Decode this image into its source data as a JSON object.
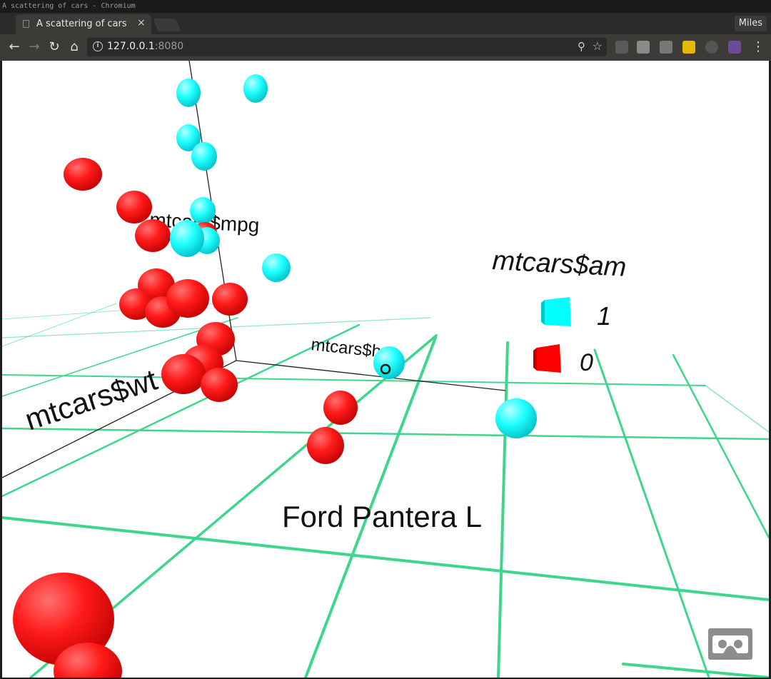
{
  "window": {
    "title": "A scattering of cars - Chromium"
  },
  "tab": {
    "title": "A scattering of cars",
    "close_glyph": "×"
  },
  "profile": {
    "name": "Miles"
  },
  "address": {
    "host": "127.0.0.1",
    "port": ":8080"
  },
  "scene": {
    "axis_labels": {
      "y": "mtcars$mpg",
      "x": "mtcars$hp",
      "z": "mtcars$wt"
    },
    "legend": {
      "title": "mtcars$am",
      "items": [
        {
          "label": "1",
          "color": "#00ffff"
        },
        {
          "label": "0",
          "color": "#ff0000"
        }
      ]
    },
    "hover_label": "Ford Pantera L",
    "grid_color": "#3dd68c"
  },
  "icons": [
    "back-icon",
    "forward-icon",
    "reload-icon",
    "home-icon",
    "info-icon",
    "zoom-icon",
    "star-icon",
    "vr-headset-icon"
  ]
}
